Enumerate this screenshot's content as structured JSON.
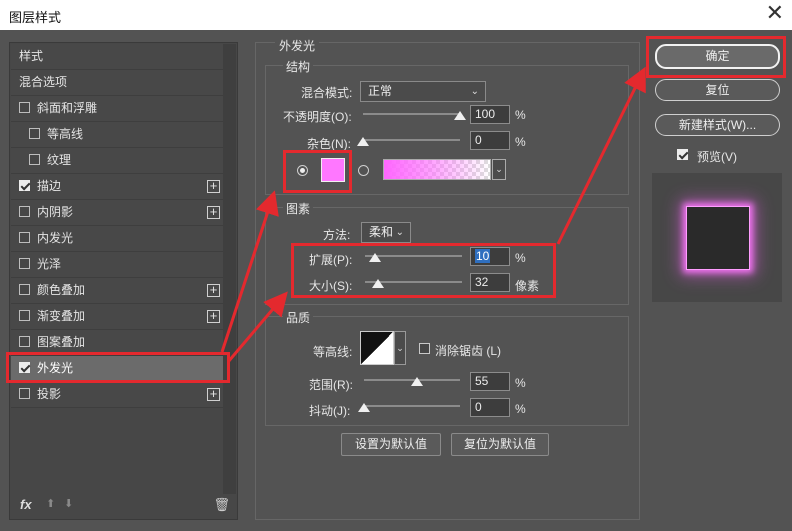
{
  "window": {
    "title": "图层样式",
    "close_glyph": "✕"
  },
  "styles_panel": {
    "items": [
      {
        "label": "样式",
        "checkbox": false,
        "plus": false
      },
      {
        "label": "混合选项",
        "checkbox": false,
        "plus": false
      },
      {
        "label": "斜面和浮雕",
        "checkbox": true,
        "checked": false,
        "plus": false
      },
      {
        "label": "等高线",
        "checkbox": true,
        "checked": false,
        "plus": false,
        "indent": true
      },
      {
        "label": "纹理",
        "checkbox": true,
        "checked": false,
        "plus": false,
        "indent": true
      },
      {
        "label": "描边",
        "checkbox": true,
        "checked": true,
        "plus": true
      },
      {
        "label": "内阴影",
        "checkbox": true,
        "checked": false,
        "plus": true
      },
      {
        "label": "内发光",
        "checkbox": true,
        "checked": false,
        "plus": false
      },
      {
        "label": "光泽",
        "checkbox": true,
        "checked": false,
        "plus": false
      },
      {
        "label": "颜色叠加",
        "checkbox": true,
        "checked": false,
        "plus": true
      },
      {
        "label": "渐变叠加",
        "checkbox": true,
        "checked": false,
        "plus": true
      },
      {
        "label": "图案叠加",
        "checkbox": true,
        "checked": false,
        "plus": false
      },
      {
        "label": "外发光",
        "checkbox": true,
        "checked": true,
        "plus": false,
        "selected": true
      },
      {
        "label": "投影",
        "checkbox": true,
        "checked": false,
        "plus": true
      }
    ],
    "bottom": {
      "fx": "fx",
      "up": "⬆",
      "down": "⬇",
      "trash": "🗑"
    }
  },
  "outer_glow": {
    "title": "外发光",
    "structure": {
      "label": "结构",
      "blend_mode_label": "混合模式:",
      "blend_mode_value": "正常",
      "opacity_label": "不透明度(O):",
      "opacity_value": "100",
      "opacity_fraction": 1.0,
      "noise_label": "杂色(N):",
      "noise_value": "0",
      "noise_fraction": 0.0,
      "percent": "%",
      "swatch_color": "#ff77ff"
    },
    "elements": {
      "label": "图素",
      "technique_label": "方法:",
      "technique_value": "柔和",
      "spread_label": "扩展(P):",
      "spread_value": "10",
      "spread_fraction": 0.1,
      "size_label": "大小(S):",
      "size_value": "32",
      "size_fraction": 0.13,
      "percent": "%",
      "pixels": "像素"
    },
    "quality": {
      "label": "品质",
      "contour_label": "等高线:",
      "anti_alias_label": "消除锯齿 (L)",
      "range_label": "范围(R):",
      "range_value": "55",
      "range_fraction": 0.55,
      "jitter_label": "抖动(J):",
      "jitter_value": "0",
      "jitter_fraction": 0.0,
      "percent": "%"
    },
    "buttons": {
      "make_default": "设置为默认值",
      "reset_default": "复位为默认值"
    }
  },
  "right_panel": {
    "ok": "确定",
    "reset": "复位",
    "new_style": "新建样式(W)...",
    "preview_label": "预览(V)",
    "preview_checked": true,
    "glow_color": "#ff77ff"
  },
  "annotation_color": "#e4292e"
}
